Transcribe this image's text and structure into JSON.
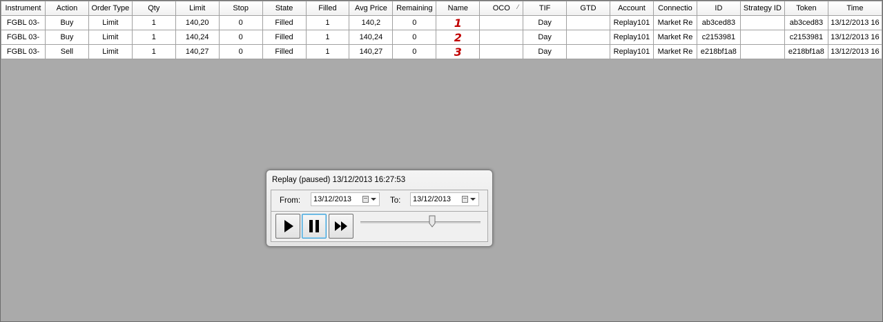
{
  "orders": {
    "columns": [
      "Instrument",
      "Action",
      "Order Type",
      "Qty",
      "Limit",
      "Stop",
      "State",
      "Filled",
      "Avg Price",
      "Remaining",
      "Name",
      "OCO",
      "TIF",
      "GTD",
      "Account",
      "Connectio",
      "ID",
      "Strategy ID",
      "Token",
      "Time"
    ],
    "rows": [
      [
        "FGBL 03-",
        "Buy",
        "Limit",
        "1",
        "140,20",
        "0",
        "Filled",
        "1",
        "140,2",
        "0",
        "1",
        "",
        "Day",
        "",
        "Replay101",
        "Market Re",
        "ab3ced83",
        "",
        "ab3ced83",
        "13/12/2013 16"
      ],
      [
        "FGBL 03-",
        "Buy",
        "Limit",
        "1",
        "140,24",
        "0",
        "Filled",
        "1",
        "140,24",
        "0",
        "2",
        "",
        "Day",
        "",
        "Replay101",
        "Market Re",
        "c2153981",
        "",
        "c2153981",
        "13/12/2013 16"
      ],
      [
        "FGBL 03-",
        "Sell",
        "Limit",
        "1",
        "140,27",
        "0",
        "Filled",
        "1",
        "140,27",
        "0",
        "3",
        "",
        "Day",
        "",
        "Replay101",
        "Market Re",
        "e218bf1a8",
        "",
        "e218bf1a8",
        "13/12/2013 16"
      ]
    ],
    "sort_glyph": "⁄"
  },
  "replay": {
    "title": "Replay (paused) 13/12/2013 16:27:53",
    "from_label": "From:",
    "from_value": "13/12/2013",
    "to_label": "To:",
    "to_value": "13/12/2013",
    "slider_position": 0.6,
    "icons": {
      "play": "play-icon",
      "pause": "pause-icon",
      "fast_forward": "fast-forward-icon",
      "calendar": "calendar-icon"
    }
  }
}
